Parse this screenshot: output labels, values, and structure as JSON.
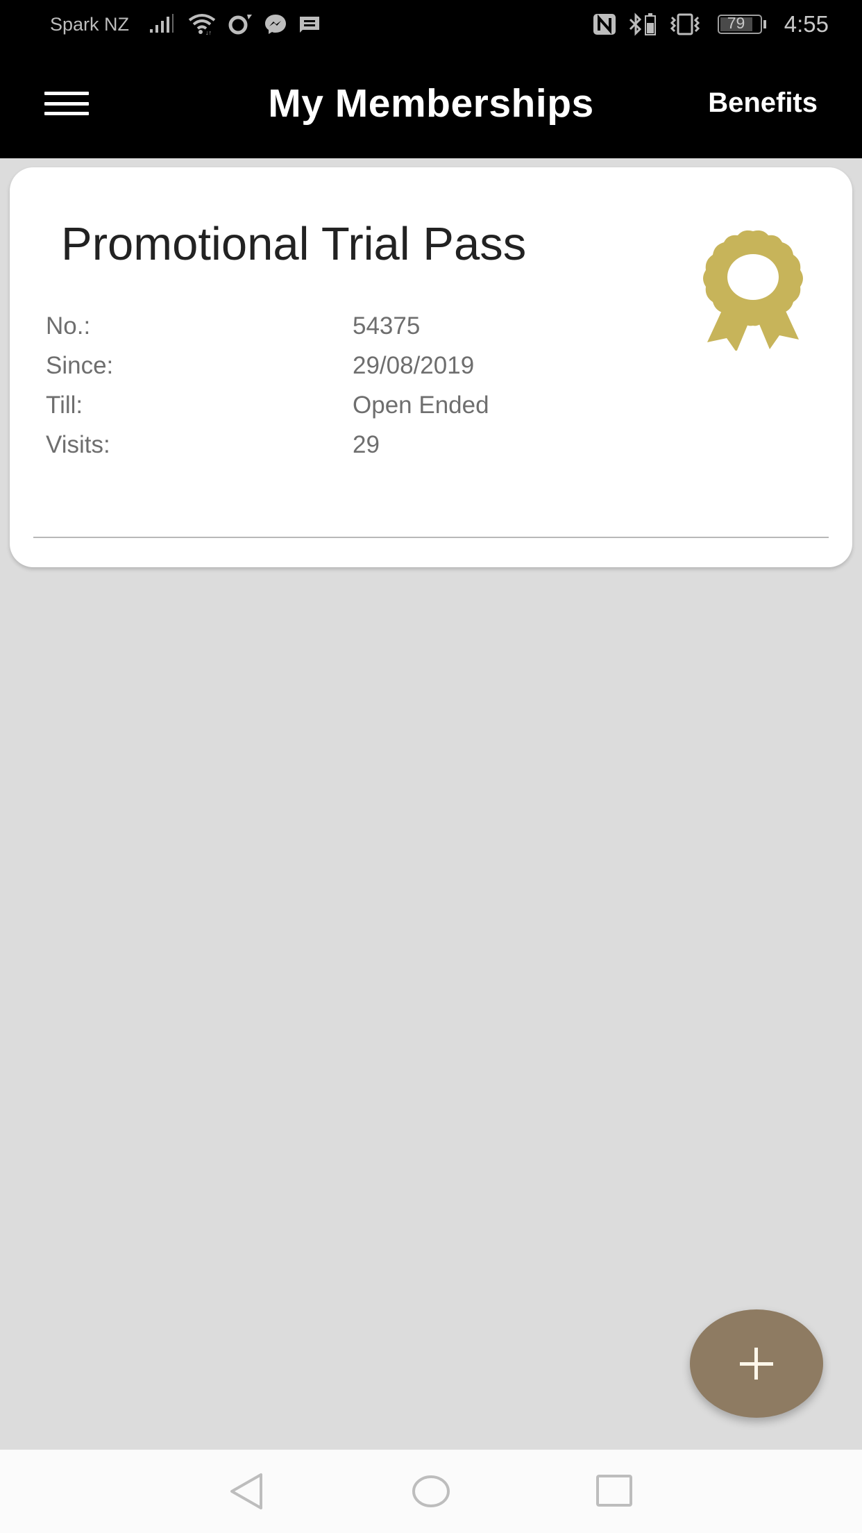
{
  "status_bar": {
    "carrier": "Spark NZ",
    "left_icons": [
      "signal-icon",
      "wifi-icon",
      "opera-icon",
      "messenger-icon",
      "notification-icon"
    ],
    "right_icons": [
      "nfc-icon",
      "bluetooth-battery-icon",
      "vibrate-icon"
    ],
    "battery_level": "79",
    "time": "4:55"
  },
  "app_bar": {
    "menu_icon": "hamburger-menu-icon",
    "title": "My Memberships",
    "benefits_label": "Benefits"
  },
  "memberships": [
    {
      "name": "Promotional Trial Pass",
      "icon": "award-ribbon-icon",
      "fields": [
        {
          "label": "No.:",
          "value": "54375"
        },
        {
          "label": "Since:",
          "value": "29/08/2019"
        },
        {
          "label": "Till:",
          "value": "Open Ended"
        },
        {
          "label": "Visits:",
          "value": "29"
        }
      ]
    }
  ],
  "fab": {
    "icon": "plus-icon"
  },
  "nav_bar": {
    "items": [
      "back-icon",
      "home-icon",
      "recents-icon"
    ]
  },
  "colors": {
    "app_bar": "#000000",
    "background": "#dcdcdc",
    "award_gold": "#c7b45a",
    "fab": "#8e7b62",
    "label_text": "#6e6e6e"
  }
}
